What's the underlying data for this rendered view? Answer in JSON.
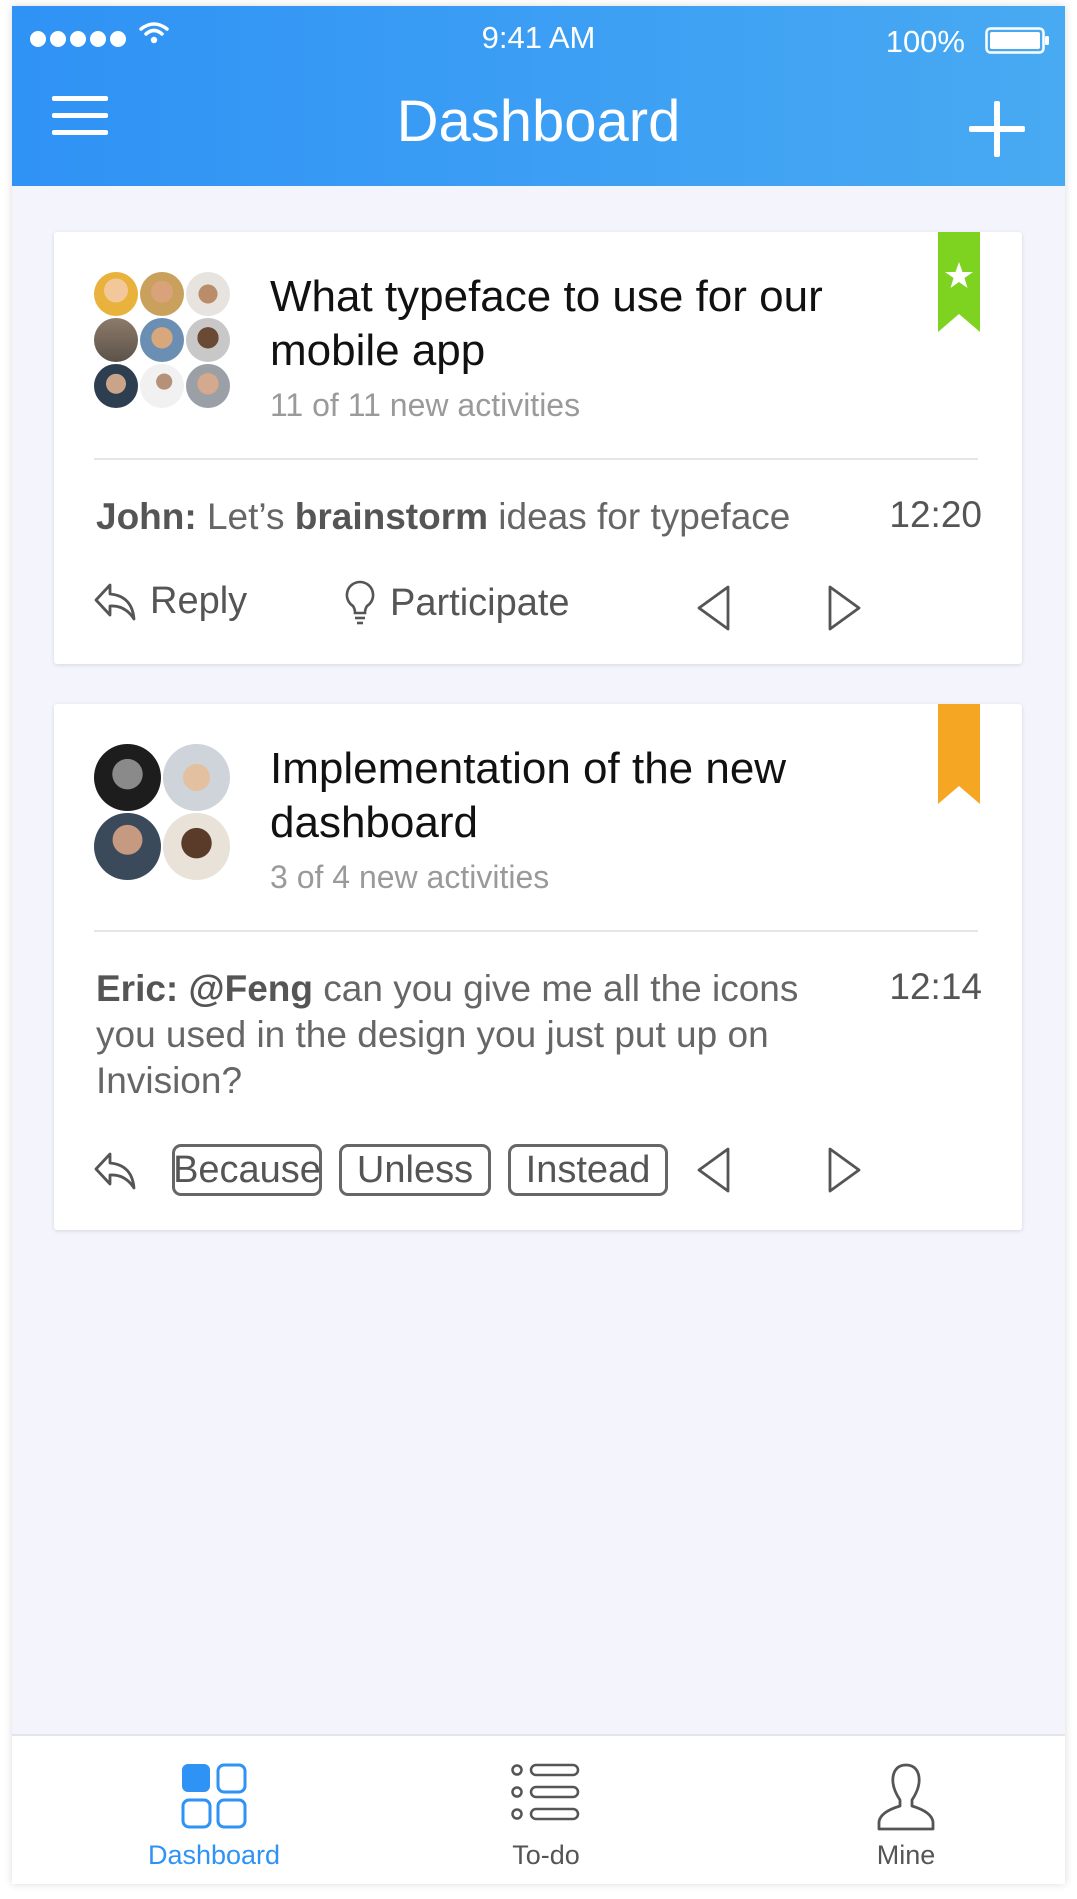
{
  "status_bar": {
    "time": "9:41 AM",
    "battery": "100%"
  },
  "header": {
    "title": "Dashboard"
  },
  "cards": [
    {
      "title": "What typeface to use for our mobile app",
      "subtitle": "11 of 11 new activities",
      "bookmark_color": "#7ed321",
      "bookmark_icon": "star-icon",
      "message": {
        "author": "John:",
        "pre": " Let’s ",
        "bold": "brainstorm",
        "post": " ideas for typeface"
      },
      "time": "12:20",
      "actions": {
        "reply": "Reply",
        "participate": "Participate"
      }
    },
    {
      "title": "Implementation of the new dashboard",
      "subtitle": "3 of 4 new activities",
      "bookmark_color": "#f5a623",
      "message": {
        "author": "Eric:",
        "mention": " @Feng",
        "post": " can you give me all the icons you used in the design you just put up on Invision?"
      },
      "time": "12:14",
      "chips": [
        "Because",
        "Unless",
        "Instead"
      ]
    }
  ],
  "tabs": [
    {
      "label": "Dashboard",
      "icon": "dashboard-icon",
      "active": true
    },
    {
      "label": "To-do",
      "icon": "todo-list-icon",
      "active": false
    },
    {
      "label": "Mine",
      "icon": "person-icon",
      "active": false
    }
  ],
  "colors": {
    "accent": "#2f92f5",
    "background": "#f3f4fc"
  }
}
